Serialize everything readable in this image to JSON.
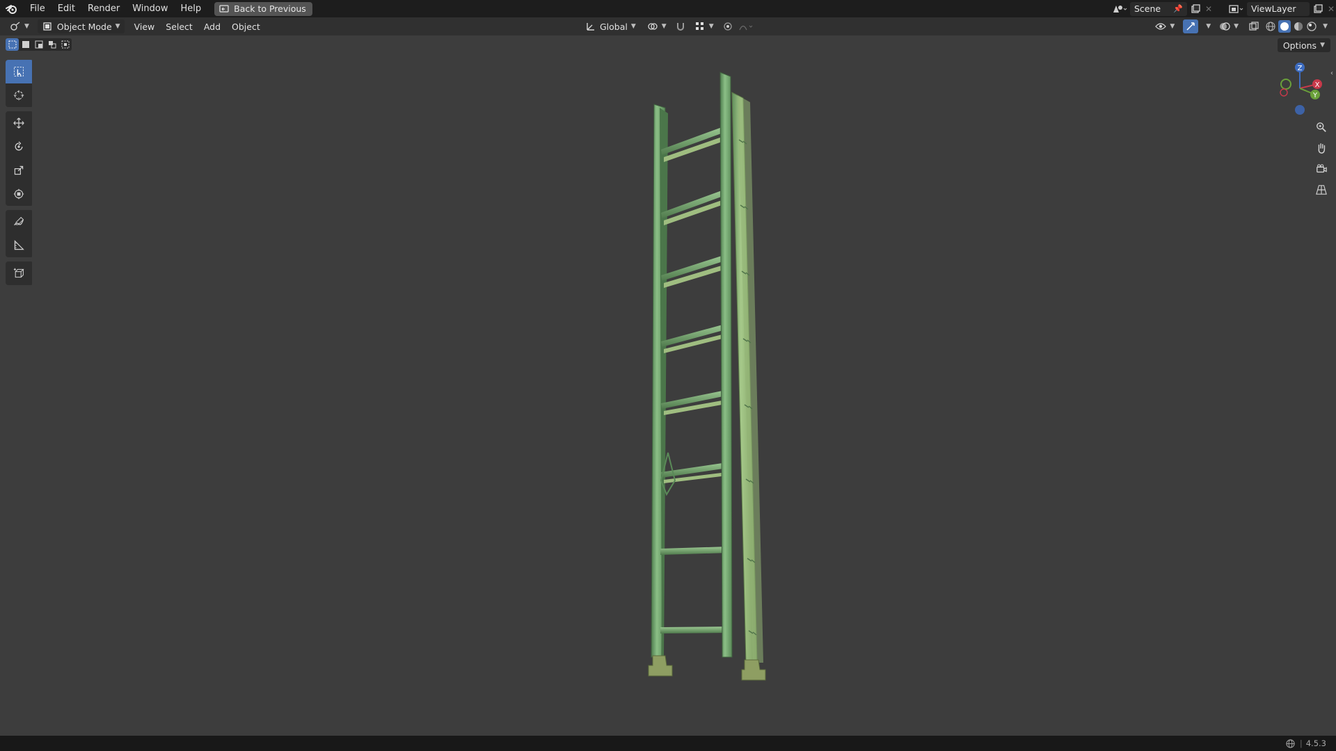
{
  "topbar": {
    "menus": [
      "File",
      "Edit",
      "Render",
      "Window",
      "Help"
    ],
    "back_button": "Back to Previous",
    "scene_name": "Scene",
    "view_layer": "ViewLayer"
  },
  "header": {
    "mode": "Object Mode",
    "menus": [
      "View",
      "Select",
      "Add",
      "Object"
    ],
    "orientation": "Global",
    "options": "Options"
  },
  "gizmo": {
    "z": "Z",
    "x": "X",
    "y": "Y"
  },
  "statusbar": {
    "version": "4.5.3"
  },
  "colors": {
    "accent": "#4772b3",
    "viewport_bg": "#3d3d3d",
    "model": "#6f9f6c"
  },
  "icons": [
    "blender-logo-icon",
    "editor-type-icon",
    "mode-icon",
    "select-box-icon",
    "cursor-icon",
    "move-icon",
    "rotate-icon",
    "scale-icon",
    "transform-icon",
    "annotate-icon",
    "measure-icon",
    "add-cube-icon",
    "zoom-icon",
    "pan-hand-icon",
    "camera-icon",
    "grid-perspective-icon"
  ]
}
